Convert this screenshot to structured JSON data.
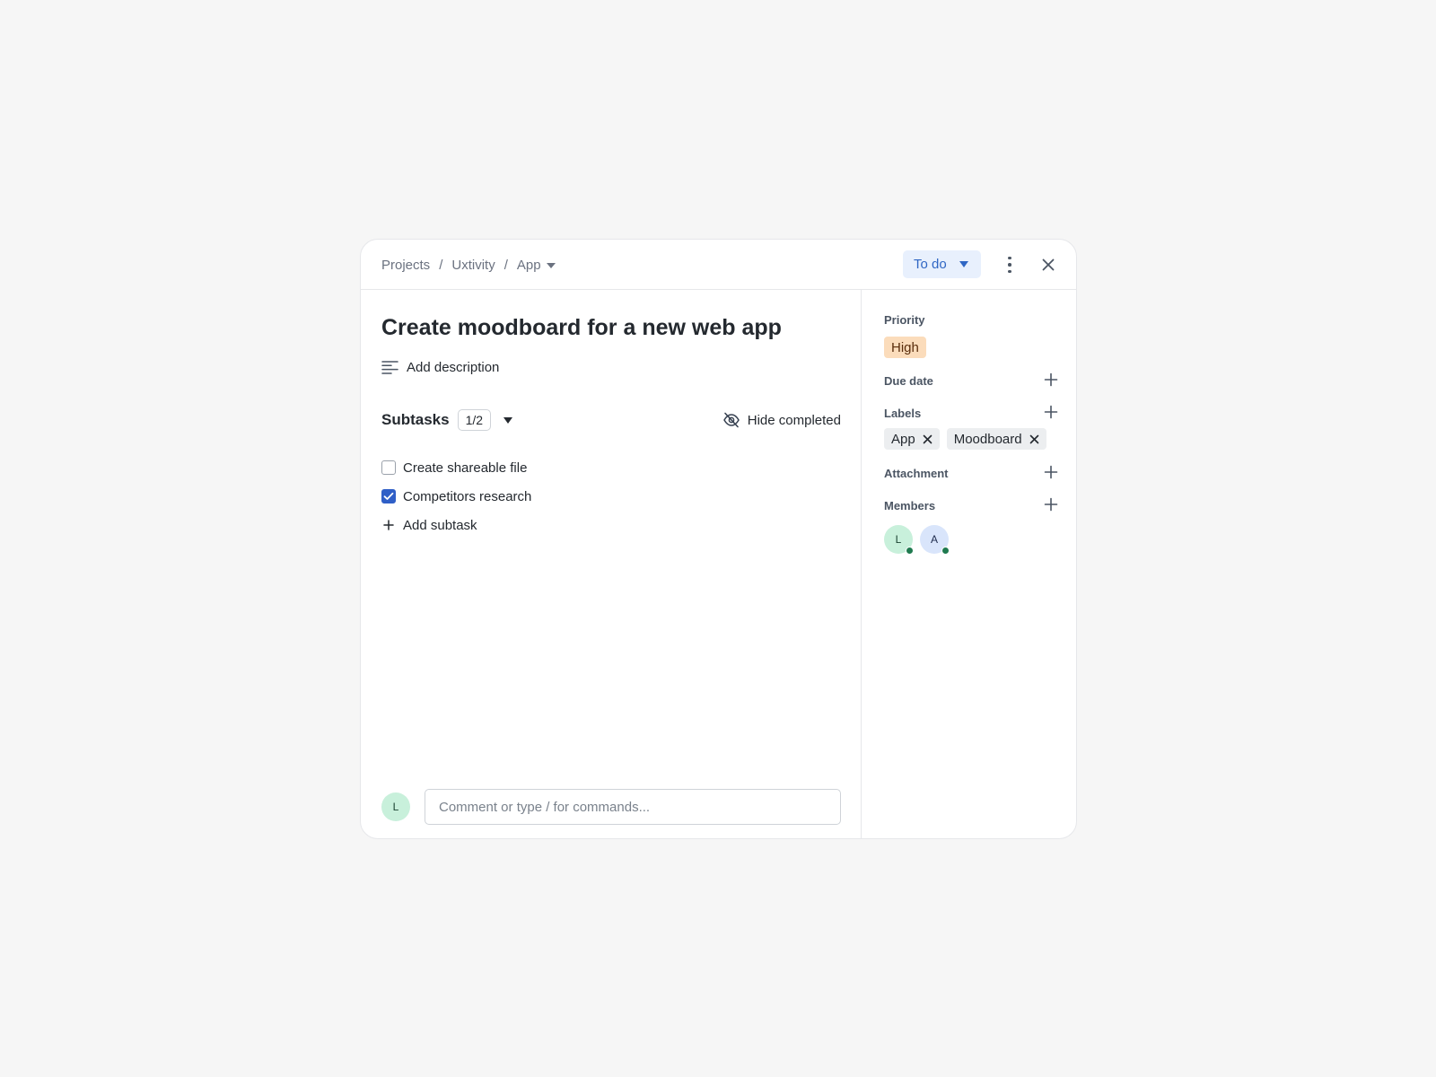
{
  "breadcrumb": {
    "items": [
      "Projects",
      "Uxtivity",
      "App"
    ],
    "separator": "/"
  },
  "status": {
    "label": "To do"
  },
  "task": {
    "title": "Create moodboard for a new web app",
    "add_description_label": "Add description"
  },
  "subtasks": {
    "title": "Subtasks",
    "count": "1/2",
    "hide_completed_label": "Hide completed",
    "items": [
      {
        "label": "Create shareable file",
        "checked": false
      },
      {
        "label": "Competitors research",
        "checked": true
      }
    ],
    "add_label": "Add subtask"
  },
  "comment": {
    "avatar_initial": "L",
    "placeholder": "Comment or type / for commands..."
  },
  "side": {
    "priority_label": "Priority",
    "priority_value": "High",
    "due_date_label": "Due date",
    "labels_label": "Labels",
    "labels": [
      "App",
      "Moodboard"
    ],
    "attachment_label": "Attachment",
    "members_label": "Members",
    "members": [
      "L",
      "A"
    ]
  },
  "colors": {
    "accent": "#2f5fc7",
    "status_bg": "#e8f0fd",
    "priority_high_bg": "#fbdcbb",
    "presence_online": "#1f7a4f"
  },
  "icons": {
    "description": "text-align-left-icon",
    "hide_completed": "eye-off-icon",
    "more": "more-vertical-icon",
    "close": "close-icon",
    "add": "plus-icon",
    "remove": "x-icon"
  }
}
